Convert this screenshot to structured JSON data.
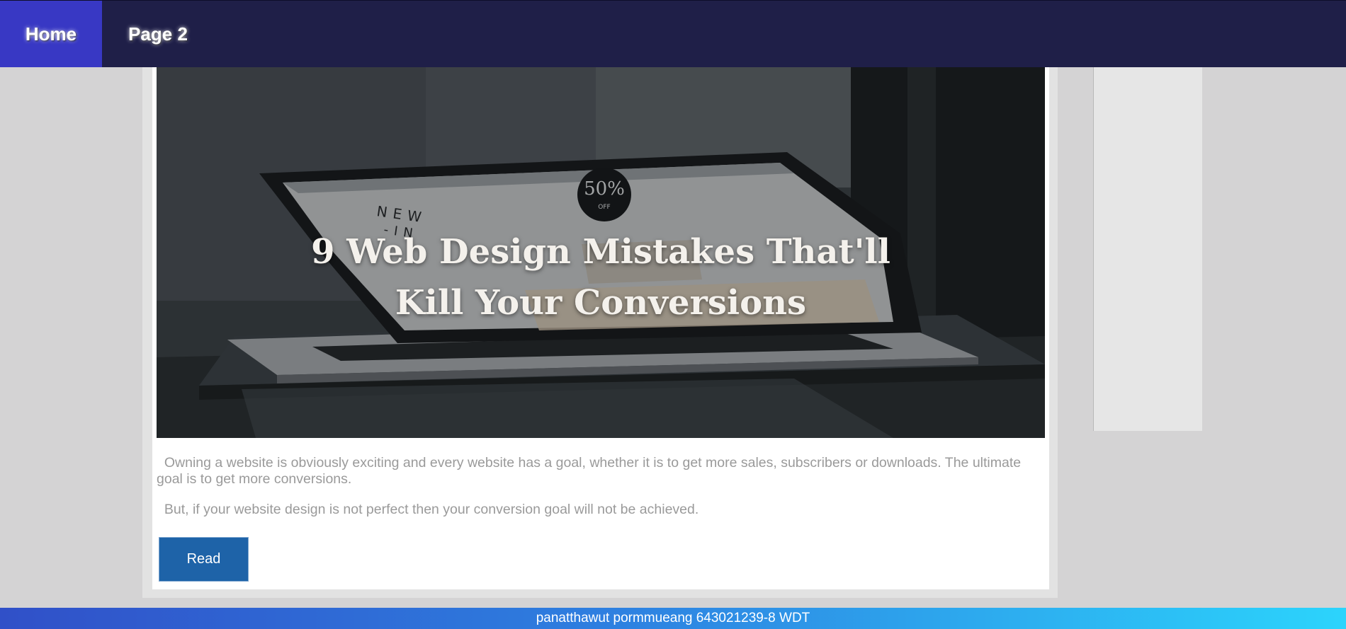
{
  "nav": {
    "items": [
      {
        "label": "Home",
        "active": true
      },
      {
        "label": "Page 2",
        "active": false
      }
    ],
    "background_color": "#1f1f48",
    "active_color": "#3838c4"
  },
  "article": {
    "hero_title": "9 Web Design Mistakes That'll Kill Your Conversions",
    "hero_image_text": {
      "sign_left": "NEW -IN",
      "badge": "50%",
      "badge_sub": "OFF"
    },
    "paragraphs": [
      "Owning a website is obviously exciting and every website has a goal, whether it is to get more sales, subscribers or downloads. The ultimate goal is to get more conversions.",
      "But, if your website design is not perfect then your conversion goal will not be achieved."
    ],
    "read_button_label": "Read",
    "button_color": "#1e63a8"
  },
  "footer": {
    "text": "panatthawut pormmueang 643021239-8 WDT"
  }
}
